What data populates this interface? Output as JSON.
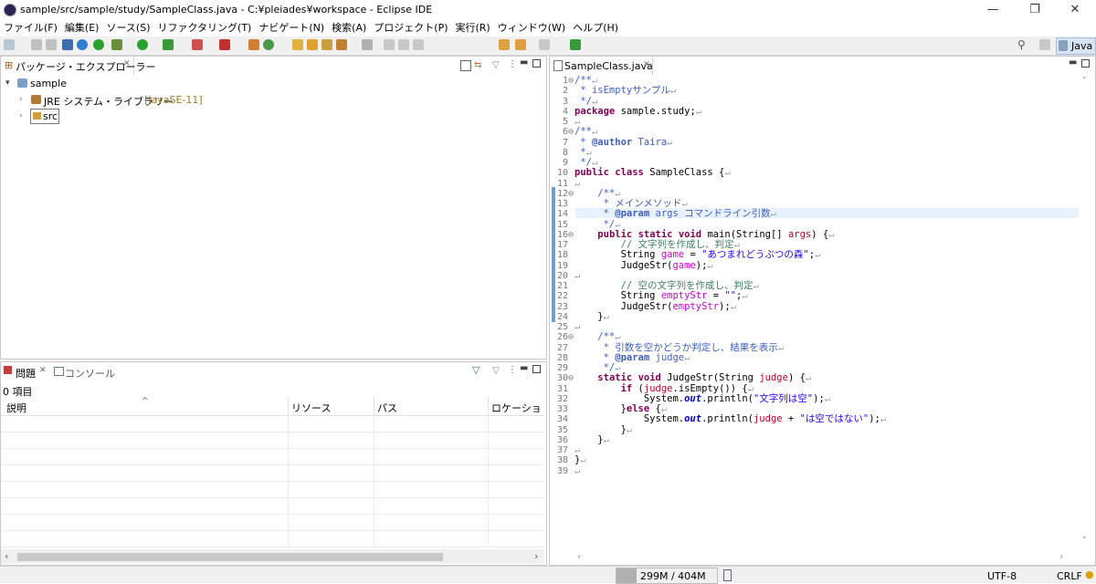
{
  "window": {
    "title": "sample/src/sample/study/SampleClass.java - C:¥pleiades¥workspace - Eclipse IDE",
    "minimize": "—",
    "maximize": "❐",
    "close": "✕"
  },
  "menu": [
    "ファイル(F)",
    "編集(E)",
    "ソース(S)",
    "リファクタリング(T)",
    "ナビゲート(N)",
    "検索(A)",
    "プロジェクト(P)",
    "実行(R)",
    "ウィンドウ(W)",
    "ヘルプ(H)"
  ],
  "toolbar": {
    "perspective": "Java"
  },
  "package_explorer": {
    "tab": "パッケージ・エクスプローラー",
    "project": "sample",
    "jre_label": "JRE システム・ライブラリー",
    "jre_version": "[JavaSE-11]",
    "src": "src"
  },
  "problems": {
    "tab_problems": "問題",
    "tab_console": "コンソール",
    "count": "0 項目",
    "columns": [
      "説明",
      "リソース",
      "パス",
      "ロケーション"
    ]
  },
  "editor": {
    "tab": "SampleClass.java",
    "lines": [
      "/**",
      " * isEmptyサンプル",
      " */",
      "package sample.study;",
      "",
      "/**",
      " * @author Taira",
      " *",
      " */",
      "public class SampleClass {",
      "",
      "    /**",
      "     * メインメソッド",
      "     * @param args コマンドライン引数",
      "     */",
      "    public static void main(String[] args) {",
      "        // 文字列を作成し、判定",
      "        String game = \"あつまれどうぶつの森\";",
      "        JudgeStr(game);",
      "",
      "        // 空の文字列を作成し、判定",
      "        String emptyStr = \"\";",
      "        JudgeStr(emptyStr);",
      "    }",
      "",
      "    /**",
      "     * 引数を空かどうか判定し、結果を表示",
      "     * @param judge",
      "     */",
      "    static void JudgeStr(String judge) {",
      "        if (judge.isEmpty()) {",
      "            System.out.println(\"文字列は空\");",
      "        }else {",
      "            System.out.println(judge + \"は空ではない\");",
      "        }",
      "    }",
      "",
      "}",
      ""
    ]
  },
  "status": {
    "heap": "299M / 404M",
    "encoding": "UTF-8",
    "line_ending": "CRLF"
  }
}
